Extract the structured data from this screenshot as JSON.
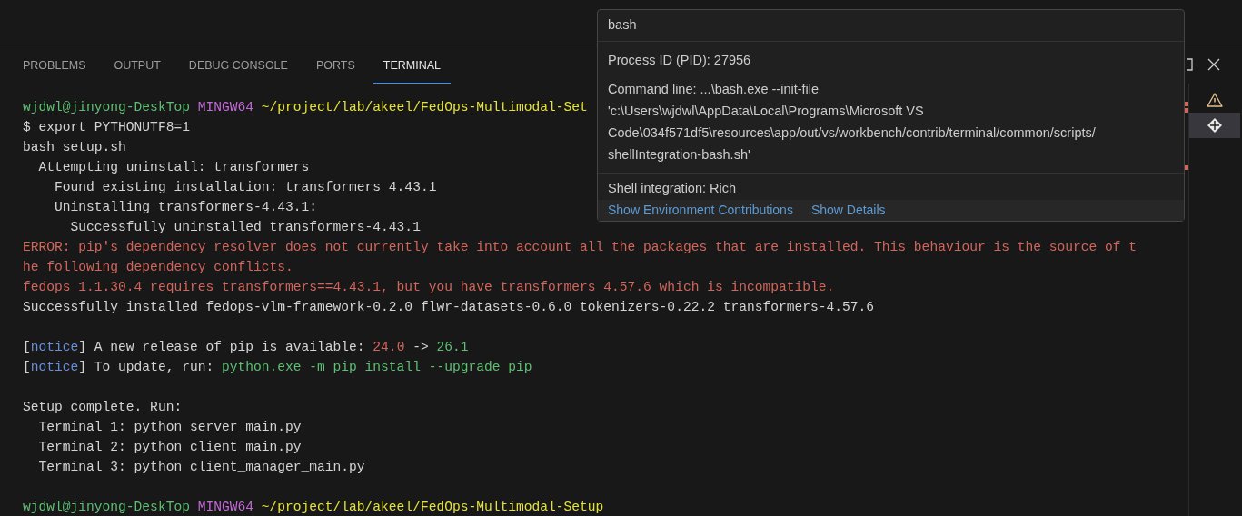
{
  "panel_tabs": [
    {
      "label": "PROBLEMS",
      "selected": false
    },
    {
      "label": "OUTPUT",
      "selected": false
    },
    {
      "label": "DEBUG CONSOLE",
      "selected": false
    },
    {
      "label": "PORTS",
      "selected": false
    },
    {
      "label": "TERMINAL",
      "selected": true
    }
  ],
  "terminal_lines": [
    {
      "kind": "text",
      "segments": [
        {
          "text": "wjdwl@jinyong-DeskTop",
          "kind": "user"
        },
        {
          "text": " MINGW64",
          "kind": "system"
        },
        {
          "text": " ~/project/lab/akeel/FedOps-Multimodal-Set",
          "kind": "path"
        }
      ]
    },
    {
      "kind": "text",
      "segments": [
        {
          "text": "$ export PYTHONUTF8=1"
        }
      ]
    },
    {
      "kind": "text",
      "segments": [
        {
          "text": "bash setup.sh"
        }
      ]
    },
    {
      "kind": "text",
      "segments": [
        {
          "text": "  Attempting uninstall: transformers"
        }
      ]
    },
    {
      "kind": "text",
      "segments": [
        {
          "text": "    Found existing installation: transformers 4.43.1"
        }
      ]
    },
    {
      "kind": "text",
      "segments": [
        {
          "text": "    Uninstalling transformers-4.43.1:"
        }
      ]
    },
    {
      "kind": "text",
      "segments": [
        {
          "text": "      Successfully uninstalled transformers-4.43.1"
        }
      ]
    },
    {
      "kind": "text",
      "segments": [
        {
          "text": "ERROR: pip's dependency resolver does not currently take into account all the packages that are installed. This behaviour is the source of t",
          "kind": "error"
        }
      ]
    },
    {
      "kind": "text",
      "segments": [
        {
          "text": "he following dependency conflicts.",
          "kind": "error"
        }
      ]
    },
    {
      "kind": "text",
      "segments": [
        {
          "text": "fedops 1.1.30.4 requires transformers==4.43.1, but you have transformers 4.57.6 which is incompatible.",
          "kind": "error"
        }
      ]
    },
    {
      "kind": "text",
      "segments": [
        {
          "text": "Successfully installed fedops-vlm-framework-0.2.0 flwr-datasets-0.6.0 tokenizers-0.22.2 transformers-4.57.6"
        }
      ]
    },
    {
      "kind": "blank"
    },
    {
      "kind": "text",
      "segments": [
        {
          "text": "["
        },
        {
          "text": "notice",
          "kind": "notice"
        },
        {
          "text": "] A new release of pip is available: "
        },
        {
          "text": "24.0",
          "kind": "error"
        },
        {
          "text": " -> "
        },
        {
          "text": "26.1",
          "kind": "success"
        }
      ]
    },
    {
      "kind": "text",
      "segments": [
        {
          "text": "["
        },
        {
          "text": "notice",
          "kind": "notice"
        },
        {
          "text": "] To update, run: "
        },
        {
          "text": "python.exe -m pip install --upgrade pip",
          "kind": "success"
        }
      ]
    },
    {
      "kind": "blank"
    },
    {
      "kind": "text",
      "segments": [
        {
          "text": "Setup complete. Run:"
        }
      ]
    },
    {
      "kind": "text",
      "segments": [
        {
          "text": "  Terminal 1: python server_main.py"
        }
      ]
    },
    {
      "kind": "text",
      "segments": [
        {
          "text": "  Terminal 2: python client_main.py"
        }
      ]
    },
    {
      "kind": "text",
      "segments": [
        {
          "text": "  Terminal 3: python client_manager_main.py"
        }
      ]
    },
    {
      "kind": "blank"
    },
    {
      "kind": "text",
      "segments": [
        {
          "text": "wjdwl@jinyong-DeskTop",
          "kind": "user"
        },
        {
          "text": " MINGW64",
          "kind": "system"
        },
        {
          "text": " ~/project/lab/akeel/FedOps-Multimodal-Setup",
          "kind": "path"
        }
      ]
    }
  ],
  "terminal_list": [
    {
      "kind": "warning",
      "selected": false
    },
    {
      "kind": "shell",
      "selected": true
    }
  ],
  "hover": {
    "title": "bash",
    "pid": "Process ID (PID): 27956",
    "command_lines": [
      "Command line: ...\\bash.exe --init-file",
      "'c:\\Users\\wjdwl\\AppData\\Local\\Programs\\Microsoft VS",
      "Code\\034f571df5\\resources\\app/out/vs/workbench/contrib/terminal/common/scripts/",
      "shellIntegration-bash.sh'"
    ],
    "shell_integration": "Shell integration: Rich",
    "links": [
      "Show Environment Contributions",
      "Show Details"
    ]
  }
}
